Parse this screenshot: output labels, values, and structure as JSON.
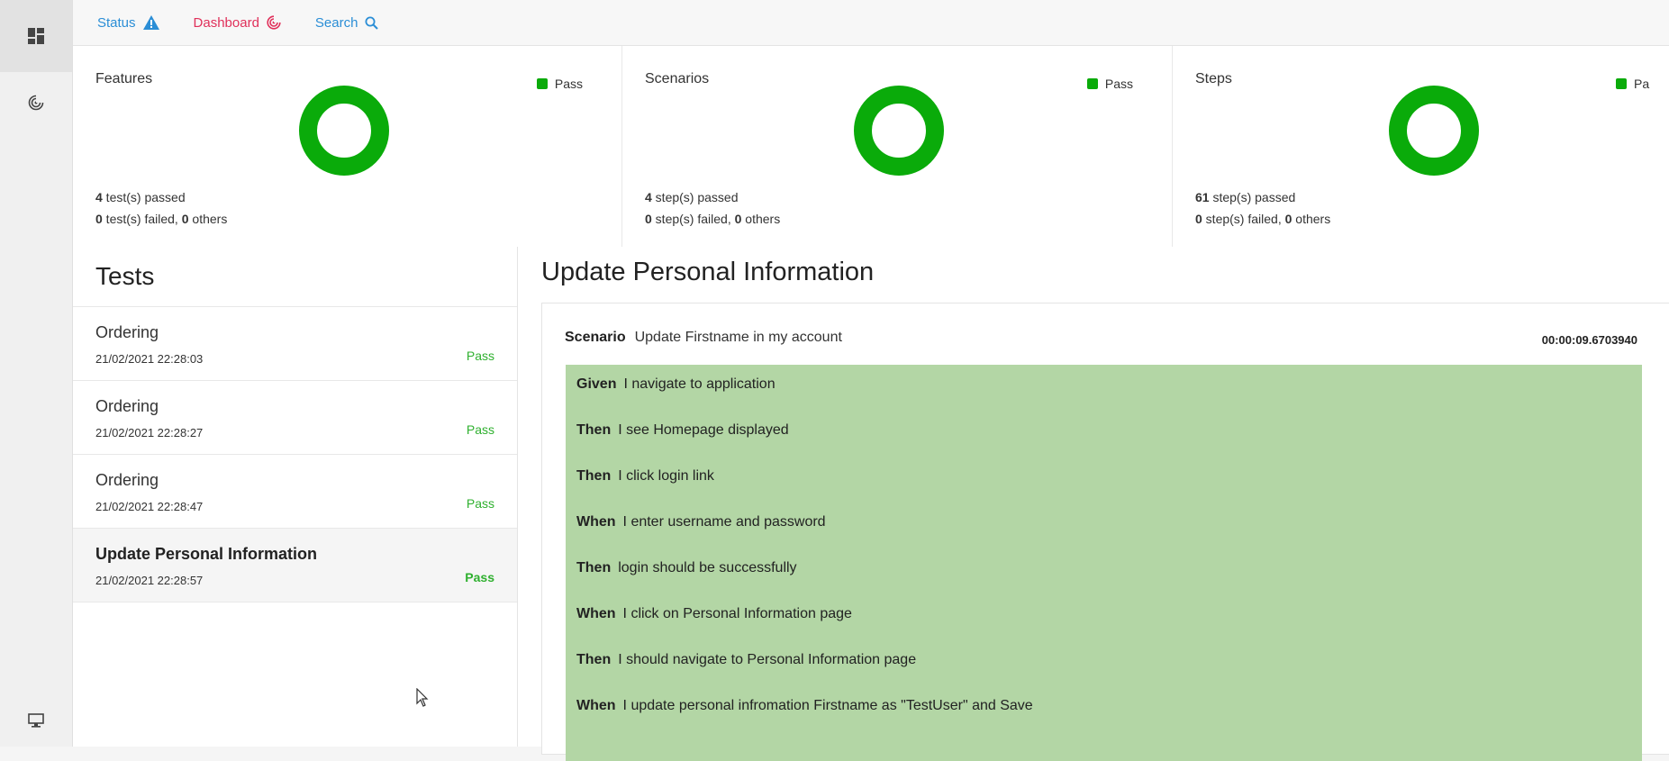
{
  "nav": {
    "status": "Status",
    "dashboard": "Dashboard",
    "search": "Search"
  },
  "colors": {
    "pass": "#0aab0a",
    "status_blue": "#2b8ed6",
    "dashboard_red": "#e0305a",
    "step_pass_bg": "#b3d6a5"
  },
  "cards": [
    {
      "title": "Features",
      "legend": "Pass",
      "passed_count": "4",
      "passed_text": " test(s) passed",
      "failed_count": "0",
      "failed_text": " test(s) failed, ",
      "others_count": "0",
      "others_text": " others",
      "pass_ratio": 1
    },
    {
      "title": "Scenarios",
      "legend": "Pass",
      "passed_count": "4",
      "passed_text": " step(s) passed",
      "failed_count": "0",
      "failed_text": " step(s) failed, ",
      "others_count": "0",
      "others_text": " others",
      "pass_ratio": 1
    },
    {
      "title": "Steps",
      "legend": "Pa",
      "passed_count": "61",
      "passed_text": " step(s) passed",
      "failed_count": "0",
      "failed_text": " step(s) failed, ",
      "others_count": "0",
      "others_text": " others",
      "pass_ratio": 1
    }
  ],
  "tests": {
    "header": "Tests",
    "items": [
      {
        "name": "Ordering",
        "date": "21/02/2021 22:28:03",
        "status": "Pass"
      },
      {
        "name": "Ordering",
        "date": "21/02/2021 22:28:27",
        "status": "Pass"
      },
      {
        "name": "Ordering",
        "date": "21/02/2021 22:28:47",
        "status": "Pass"
      },
      {
        "name": "Update Personal Information",
        "date": "21/02/2021 22:28:57",
        "status": "Pass",
        "selected": true
      }
    ]
  },
  "detail": {
    "title": "Update Personal Information",
    "scenario_label": "Scenario",
    "scenario_name": "Update Firstname in my account",
    "duration": "00:00:09.6703940",
    "steps": [
      {
        "keyword": "Given",
        "text": "I navigate to application"
      },
      {
        "keyword": "Then",
        "text": "I see Homepage displayed"
      },
      {
        "keyword": "Then",
        "text": "I click login link"
      },
      {
        "keyword": "When",
        "text": "I enter username and password"
      },
      {
        "keyword": "Then",
        "text": "login should be successfully"
      },
      {
        "keyword": "When",
        "text": "I click on Personal Information page"
      },
      {
        "keyword": "Then",
        "text": "I should navigate to Personal Information page"
      },
      {
        "keyword": "When",
        "text": "I update personal infromation Firstname as \"TestUser\" and Save"
      }
    ]
  }
}
